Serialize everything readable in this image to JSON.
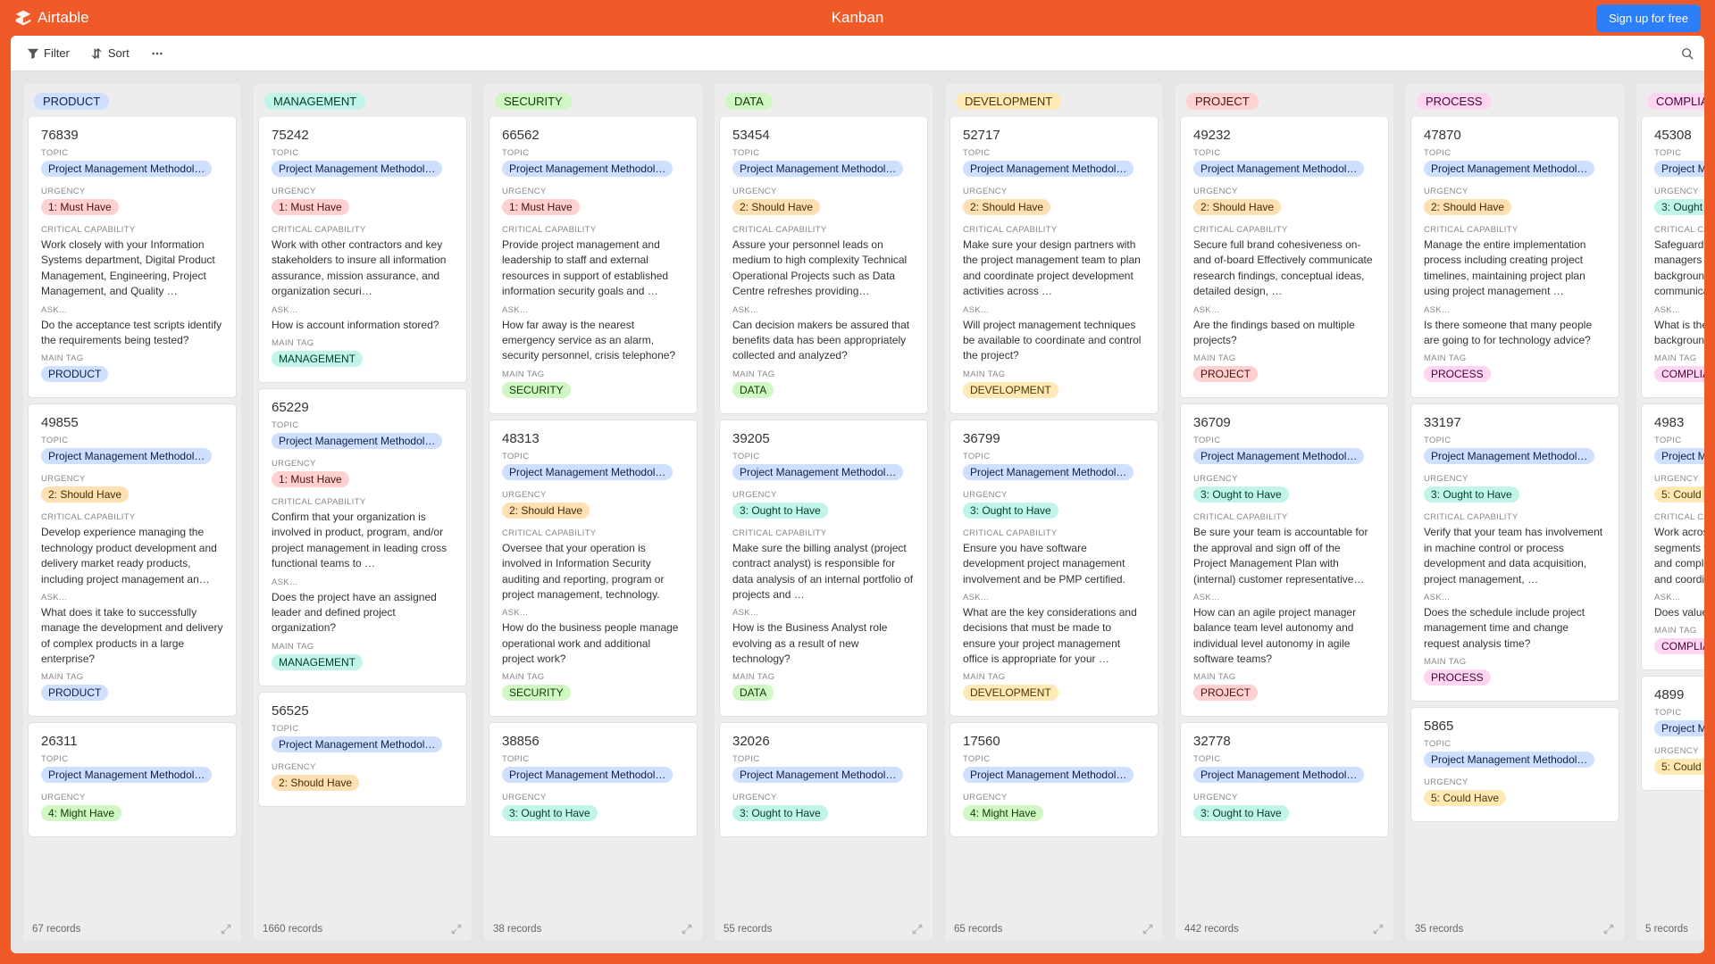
{
  "header": {
    "logo": "Airtable",
    "title": "Kanban",
    "signup": "Sign up for free"
  },
  "toolbar": {
    "filter": "Filter",
    "sort": "Sort"
  },
  "labels": {
    "topic": "TOPIC",
    "urgency": "URGENCY",
    "critical": "CRITICAL CAPABILITY",
    "ask": "ASK…",
    "maintag": "MAIN TAG"
  },
  "topic_pill": "Project Management Methodol…",
  "urgency": {
    "u1": "1: Must Have",
    "u2": "2: Should Have",
    "u3": "3: Ought to Have",
    "u4": "4: Might Have",
    "u5": "5: Could Have"
  },
  "columns": [
    {
      "name": "PRODUCT",
      "tagClass": "tag-blue",
      "records": "67 records",
      "cards": [
        {
          "id": "76839",
          "u": "u1",
          "uClass": "pill-red",
          "cap": "Work closely with your Information Systems department, Digital Product Management, Engineering, Project Management, and Quality …",
          "ask": "Do the acceptance test scripts identify the requirements being tested?",
          "tagClass": "pill-blue"
        },
        {
          "id": "49855",
          "u": "u2",
          "uClass": "pill-orange",
          "cap": "Develop experience managing the technology product development and delivery market ready products, including project management an…",
          "ask": "What does it take to successfully manage the development and delivery of complex products in a large enterprise?",
          "tagClass": "pill-blue"
        },
        {
          "id": "26311",
          "u": "u4",
          "uClass": "pill-green",
          "cap": "",
          "ask": "",
          "tagClass": "pill-blue"
        }
      ]
    },
    {
      "name": "MANAGEMENT",
      "tagClass": "tag-teal",
      "records": "1660 records",
      "cards": [
        {
          "id": "75242",
          "u": "u1",
          "uClass": "pill-red",
          "cap": "Work with other contractors and key stakeholders to insure all information assurance, mission assurance, and organization securi…",
          "ask": "How is account information stored?",
          "tagClass": "pill-teal"
        },
        {
          "id": "65229",
          "u": "u1",
          "uClass": "pill-red",
          "cap": "Confirm that your organization is involved in product, program, and/or project management in leading cross functional teams to …",
          "ask": "Does the project have an assigned leader and defined project organization?",
          "tagClass": "pill-teal"
        },
        {
          "id": "56525",
          "u": "u2",
          "uClass": "pill-orange",
          "cap": "",
          "ask": "",
          "tagClass": "pill-teal"
        }
      ]
    },
    {
      "name": "SECURITY",
      "tagClass": "tag-green",
      "records": "38 records",
      "cards": [
        {
          "id": "66562",
          "u": "u1",
          "uClass": "pill-red",
          "cap": "Provide project management and leadership to staff and external resources in support of established information security goals and …",
          "ask": "How far away is the nearest emergency service as an alarm, security personnel, crisis telephone?",
          "tagClass": "pill-green"
        },
        {
          "id": "48313",
          "u": "u2",
          "uClass": "pill-orange",
          "cap": "Oversee that your operation is involved in Information Security auditing and reporting, program or project management, technology.",
          "ask": "How do the business people manage operational work and additional project work?",
          "tagClass": "pill-green"
        },
        {
          "id": "38856",
          "u": "u3",
          "uClass": "pill-teal",
          "cap": "",
          "ask": "",
          "tagClass": "pill-green"
        }
      ]
    },
    {
      "name": "DATA",
      "tagClass": "tag-green",
      "records": "55 records",
      "cards": [
        {
          "id": "53454",
          "u": "u2",
          "uClass": "pill-orange",
          "cap": "Assure your personnel leads on medium to high complexity Technical Operational Projects such as Data Centre refreshes providing…",
          "ask": "Can decision makers be assured that benefits data has been appropriately collected and analyzed?",
          "tagClass": "pill-green"
        },
        {
          "id": "39205",
          "u": "u3",
          "uClass": "pill-teal",
          "cap": "Make sure the billing analyst (project contract analyst) is responsible for data analysis of an internal portfolio of projects and …",
          "ask": "How is the Business Analyst role evolving as a result of new technology?",
          "tagClass": "pill-green"
        },
        {
          "id": "32026",
          "u": "u3",
          "uClass": "pill-teal",
          "cap": "",
          "ask": "",
          "tagClass": "pill-green"
        }
      ]
    },
    {
      "name": "DEVELOPMENT",
      "tagClass": "tag-yellow",
      "records": "65 records",
      "cards": [
        {
          "id": "52717",
          "u": "u2",
          "uClass": "pill-orange",
          "cap": "Make sure your design partners with the project management team to plan and coordinate project development activities across …",
          "ask": "Will project management techniques be available to coordinate and control the project?",
          "tagClass": "pill-yellow"
        },
        {
          "id": "36799",
          "u": "u3",
          "uClass": "pill-teal",
          "cap": "Ensure you have software development project management involvement and be PMP certified.",
          "ask": "What are the key considerations and decisions that must be made to ensure your project management office is appropriate for your …",
          "tagClass": "pill-yellow"
        },
        {
          "id": "17560",
          "u": "u4",
          "uClass": "pill-green",
          "cap": "",
          "ask": "",
          "tagClass": "pill-yellow"
        }
      ]
    },
    {
      "name": "PROJECT",
      "tagClass": "tag-red",
      "records": "442 records",
      "cards": [
        {
          "id": "49232",
          "u": "u2",
          "uClass": "pill-orange",
          "cap": "Secure full brand cohesiveness on- and of-board Effectively communicate research findings, conceptual ideas, detailed design, …",
          "ask": "Are the findings based on multiple projects?",
          "tagClass": "pill-red"
        },
        {
          "id": "36709",
          "u": "u3",
          "uClass": "pill-teal",
          "cap": "Be sure your team is accountable for the approval and sign off of the Project Management Plan with (internal) customer representative…",
          "ask": "How can an agile project manager balance team level autonomy and individual level autonomy in agile software teams?",
          "tagClass": "pill-red"
        },
        {
          "id": "32778",
          "u": "u3",
          "uClass": "pill-teal",
          "cap": "",
          "ask": "",
          "tagClass": "pill-red"
        }
      ]
    },
    {
      "name": "PROCESS",
      "tagClass": "tag-pink",
      "records": "35 records",
      "cards": [
        {
          "id": "47870",
          "u": "u2",
          "uClass": "pill-orange",
          "cap": "Manage the entire implementation process including creating project timelines, maintaining project plan using project management …",
          "ask": "Is there someone that many people are going to for technology advice?",
          "tagClass": "pill-pink"
        },
        {
          "id": "33197",
          "u": "u3",
          "uClass": "pill-teal",
          "cap": "Verify that your team has involvement in machine control or process development and data acquisition, project management, …",
          "ask": "Does the schedule include project management time and change request analysis time?",
          "tagClass": "pill-pink"
        },
        {
          "id": "5865",
          "u": "u5",
          "uClass": "pill-yellow",
          "cap": "",
          "ask": "",
          "tagClass": "pill-pink"
        }
      ]
    },
    {
      "name": "COMPLIANCE",
      "tagClass": "tag-pink",
      "records": "5 records",
      "cards": [
        {
          "id": "45308",
          "u": "u3",
          "uClass": "pill-teal",
          "cap": "Safeguard that your company managers should have a strong background in effective communication, managing audits, …",
          "ask": "What is the purpose of the project background in a project workplan?",
          "tagClass": "pill-pink"
        },
        {
          "id": "4983",
          "u": "u5",
          "uClass": "pill-yellow",
          "cap": "Work across the controls business segments to develop a certification and compliance strategy/roadmap and coordinate implementation …",
          "ask": "Does value engineering take place?",
          "tagClass": "pill-pink"
        },
        {
          "id": "4899",
          "u": "u5",
          "uClass": "pill-yellow",
          "cap": "",
          "ask": "",
          "tagClass": "pill-pink"
        }
      ]
    }
  ]
}
